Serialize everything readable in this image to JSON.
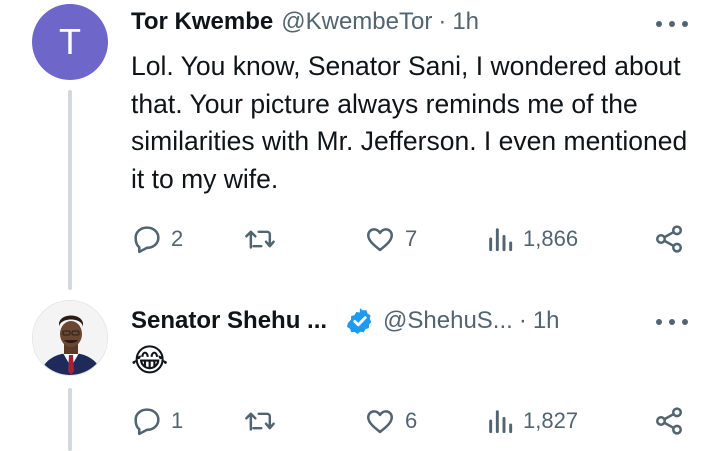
{
  "tweets": [
    {
      "avatar_initial": "T",
      "author_name": "Tor Kwembe",
      "handle": "@KwembeTor",
      "separator": "·",
      "time": "1h",
      "text": "Lol. You know, Senator Sani, I wondered about that. Your picture always reminds me of the similarities with Mr. Jefferson. I even mentioned it to my wife.",
      "replies": "2",
      "retweets": "",
      "likes": "7",
      "views": "1,866",
      "avatar_color": "#6e67c9"
    },
    {
      "author_name": "Senator Shehu ...",
      "verified": true,
      "handle": "@ShehuS...",
      "separator": "·",
      "time": "1h",
      "text": "😂",
      "replies": "1",
      "retweets": "",
      "likes": "6",
      "views": "1,827"
    }
  ],
  "colors": {
    "text": "#0f1419",
    "secondary": "#536471",
    "verified_blue": "#1d9bf0",
    "thread_line": "#cfd9de"
  },
  "icons": [
    "reply-icon",
    "retweet-icon",
    "like-icon",
    "views-icon",
    "share-icon",
    "more-icon",
    "verified-badge-icon"
  ]
}
